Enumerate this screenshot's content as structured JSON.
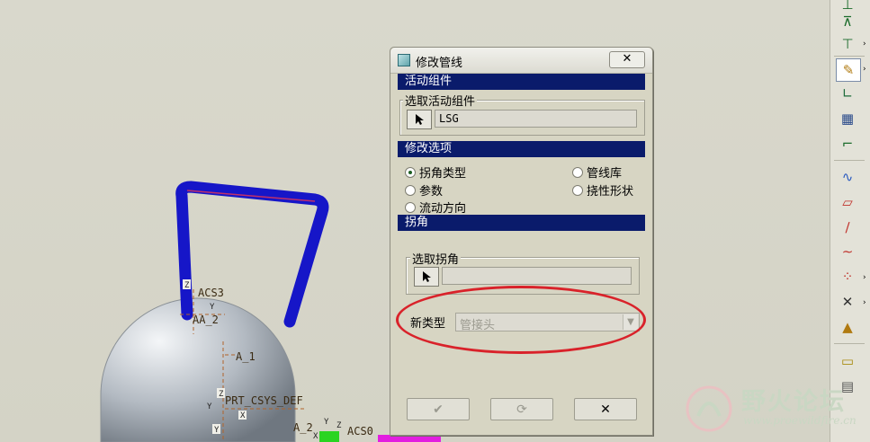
{
  "dialog": {
    "title": "修改管线",
    "close_label": "✕",
    "active_component": {
      "header": "活动组件",
      "group_title": "选取活动组件",
      "value": "LSG"
    },
    "modify_options": {
      "header": "修改选项",
      "options": [
        "拐角类型",
        "参数",
        "流动方向",
        "管线库",
        "挠性形状"
      ],
      "selected": "拐角类型"
    },
    "corner": {
      "header": "拐角",
      "group_title": "选取拐角",
      "value": "",
      "new_type_label": "新类型",
      "new_type_value": "管接头"
    },
    "footer": {
      "ok_icon": "checkmark-icon",
      "refresh_icon": "refresh-icon",
      "cancel_icon": "close-icon"
    }
  },
  "viewport": {
    "labels": [
      "ACS3",
      "AA_2",
      "A_1",
      "PRT_CSYS_DEF",
      "A_2",
      "ACS0"
    ],
    "axis_labels": [
      "Z",
      "Y",
      "Z",
      "Y",
      "X",
      "Y",
      "Z",
      "X",
      "Y"
    ],
    "pipe_color": "#1616c8",
    "body_color": "#b4bcc4"
  },
  "toolbar": {
    "icons": [
      "axis-icon",
      "datum-plane-icon",
      "sketch-icon",
      "corner-icon",
      "grid-icon",
      "route-icon",
      "curve-icon",
      "plane-icon",
      "line-icon",
      "spline-icon",
      "point-icon",
      "cross-point-icon",
      "measure-icon",
      "note-icon",
      "layer-icon"
    ]
  },
  "watermark": {
    "name": "野火论坛",
    "url": "www.proewildfire.cn"
  },
  "annotation": {
    "color": "#d9222a"
  }
}
